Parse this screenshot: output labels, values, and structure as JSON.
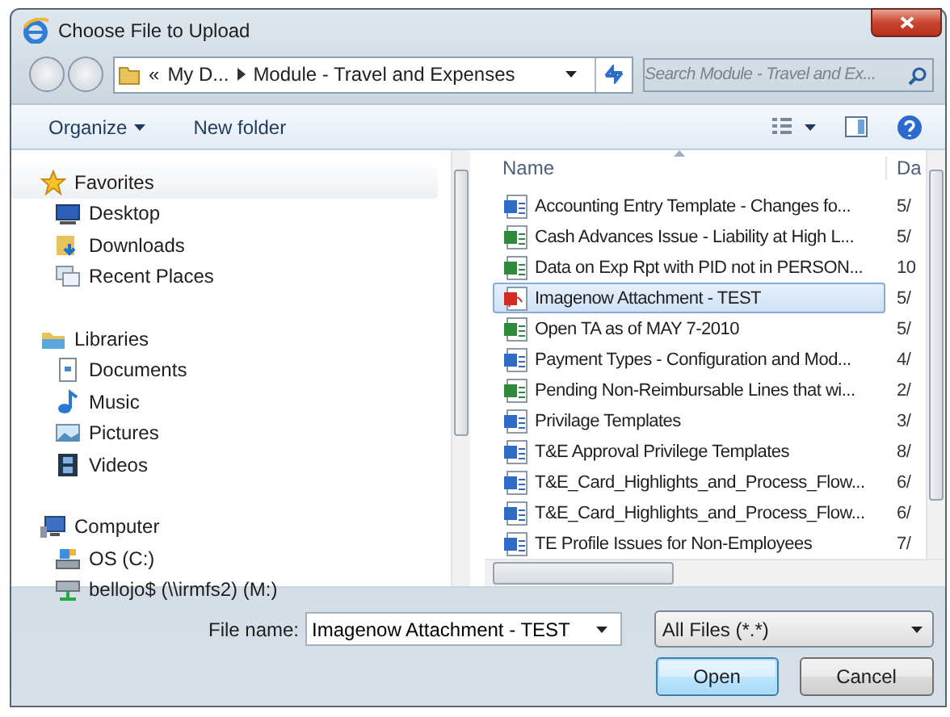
{
  "window": {
    "title": "Choose File to Upload"
  },
  "address": {
    "overflow": "«",
    "crumbs": [
      "My D...",
      "Module - Travel and Expenses"
    ]
  },
  "search": {
    "placeholder": "Search Module - Travel and Ex..."
  },
  "toolbar": {
    "organize": "Organize",
    "new_folder": "New folder"
  },
  "navigation": [
    {
      "label": "Favorites",
      "children": [
        {
          "label": "Desktop"
        },
        {
          "label": "Downloads"
        },
        {
          "label": "Recent Places"
        }
      ]
    },
    {
      "label": "Libraries",
      "children": [
        {
          "label": "Documents"
        },
        {
          "label": "Music"
        },
        {
          "label": "Pictures"
        },
        {
          "label": "Videos"
        }
      ]
    },
    {
      "label": "Computer",
      "children": [
        {
          "label": "OS (C:)"
        },
        {
          "label": "bellojo$ (\\\\irmfs2) (M:)"
        }
      ]
    }
  ],
  "file_list": {
    "columns": [
      "Name",
      "Da"
    ],
    "rows": [
      {
        "name": "Accounting Entry Template - Changes fo...",
        "date": "5/",
        "kind": "word",
        "selected": false
      },
      {
        "name": "Cash Advances Issue - Liability at High L...",
        "date": "5/",
        "kind": "excel",
        "selected": false
      },
      {
        "name": "Data on Exp Rpt with PID not in PERSON...",
        "date": "10",
        "kind": "excel",
        "selected": false
      },
      {
        "name": "Imagenow Attachment - TEST",
        "date": "5/",
        "kind": "pdf",
        "selected": true
      },
      {
        "name": "Open TA as of MAY 7-2010",
        "date": "5/",
        "kind": "excel",
        "selected": false
      },
      {
        "name": "Payment Types - Configuration and Mod...",
        "date": "4/",
        "kind": "word",
        "selected": false
      },
      {
        "name": "Pending Non-Reimbursable Lines that wi...",
        "date": "2/",
        "kind": "excel",
        "selected": false
      },
      {
        "name": "Privilage Templates",
        "date": "3/",
        "kind": "word",
        "selected": false
      },
      {
        "name": "T&E Approval Privilege Templates",
        "date": "8/",
        "kind": "word",
        "selected": false
      },
      {
        "name": "T&E_Card_Highlights_and_Process_Flow...",
        "date": "6/",
        "kind": "word",
        "selected": false
      },
      {
        "name": "T&E_Card_Highlights_and_Process_Flow...",
        "date": "6/",
        "kind": "word",
        "selected": false
      },
      {
        "name": "TE Profile Issues for Non-Employees",
        "date": "7/",
        "kind": "word",
        "selected": false
      }
    ]
  },
  "file_name": {
    "label": "File name:",
    "value": "Imagenow Attachment - TEST"
  },
  "file_type": {
    "value": "All Files (*.*)"
  },
  "buttons": [
    "Open",
    "Cancel"
  ]
}
